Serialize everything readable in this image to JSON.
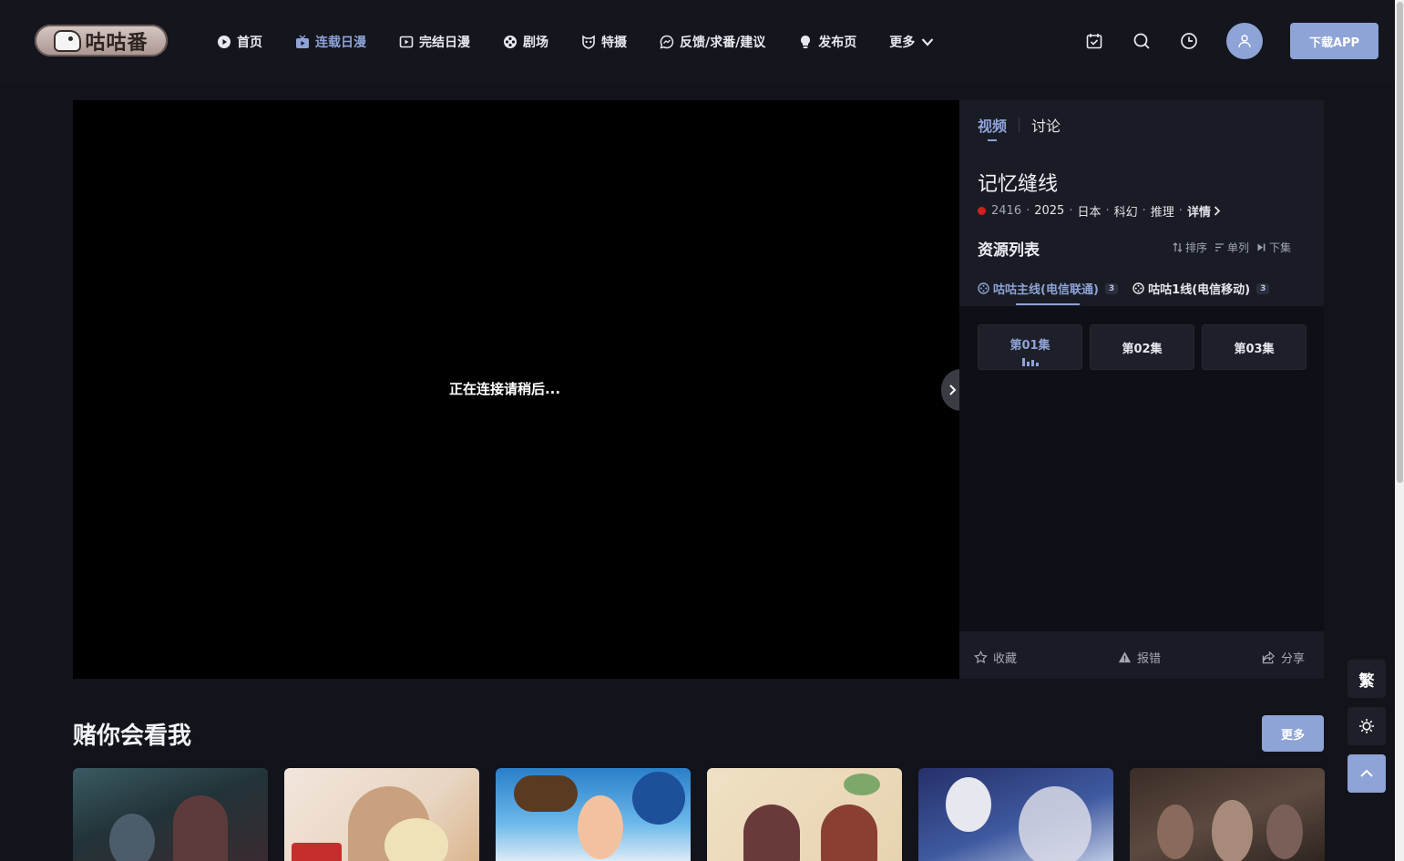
{
  "header": {
    "logo_text": "咕咕番",
    "nav": [
      {
        "label": "首页",
        "icon": "play-circle-icon",
        "active": false
      },
      {
        "label": "连载日漫",
        "icon": "tv-icon",
        "active": true
      },
      {
        "label": "完结日漫",
        "icon": "video-icon",
        "active": false
      },
      {
        "label": "剧场",
        "icon": "film-reel-icon",
        "active": false
      },
      {
        "label": "特摄",
        "icon": "mask-icon",
        "active": false
      },
      {
        "label": "反馈/求番/建议",
        "icon": "chat-icon",
        "active": false
      },
      {
        "label": "发布页",
        "icon": "lightbulb-icon",
        "active": false
      },
      {
        "label": "更多",
        "icon": "chevron-down-icon",
        "active": false
      }
    ],
    "icons": [
      "calendar-check-icon",
      "search-icon",
      "history-clock-icon"
    ],
    "avatar_icon": "user-icon",
    "download_label": "下载APP"
  },
  "player": {
    "loading_text": "正在连接请稍后..."
  },
  "panel": {
    "tabs": [
      {
        "label": "视频",
        "active": true
      },
      {
        "label": "讨论",
        "active": false
      }
    ],
    "title": "记忆缝线",
    "meta": {
      "hot_count": "2416",
      "year": "2025",
      "region": "日本",
      "genres": [
        "科幻",
        "推理"
      ],
      "detail_label": "详情"
    },
    "resources_title": "资源列表",
    "tools": [
      {
        "label": "排序",
        "icon": "sort-icon"
      },
      {
        "label": "单列",
        "icon": "list-icon"
      },
      {
        "label": "下集",
        "icon": "next-episode-icon"
      }
    ],
    "lines": [
      {
        "label": "咕咕主线(电信联通)",
        "count": "3",
        "active": true
      },
      {
        "label": "咕咕1线(电信移动)",
        "count": "3",
        "active": false
      }
    ],
    "episodes": [
      {
        "label": "第01集",
        "active": true
      },
      {
        "label": "第02集",
        "active": false
      },
      {
        "label": "第03集",
        "active": false
      }
    ],
    "actions": [
      {
        "label": "收藏",
        "icon": "star-icon"
      },
      {
        "label": "报错",
        "icon": "warning-icon"
      },
      {
        "label": "分享",
        "icon": "share-icon"
      }
    ]
  },
  "floating": {
    "traditional_label": "繁",
    "theme_icon": "sun-icon",
    "top_icon": "chevron-up-icon"
  },
  "recommend": {
    "title": "赌你会看我",
    "more_label": "更多",
    "colors": {
      "accent": "#8ea3d6",
      "bg": "#12131b",
      "panel": "#1a1c25"
    }
  }
}
